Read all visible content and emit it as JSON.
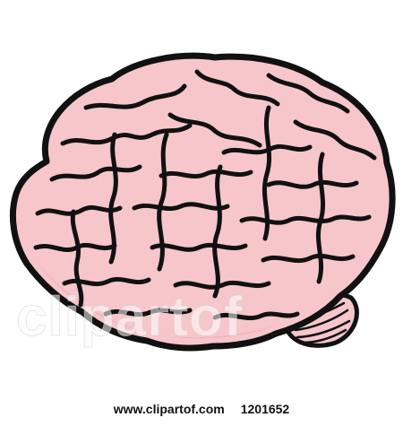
{
  "image": {
    "subject": "brain",
    "colors": {
      "fill": "#F6C6CB",
      "fill_shadow": "#EFAEB5",
      "outline": "#111111",
      "background": "#FFFFFF"
    }
  },
  "watermark": {
    "text": "clipartof"
  },
  "footer": {
    "site": "www.clipartof.com",
    "id": "1201652"
  }
}
